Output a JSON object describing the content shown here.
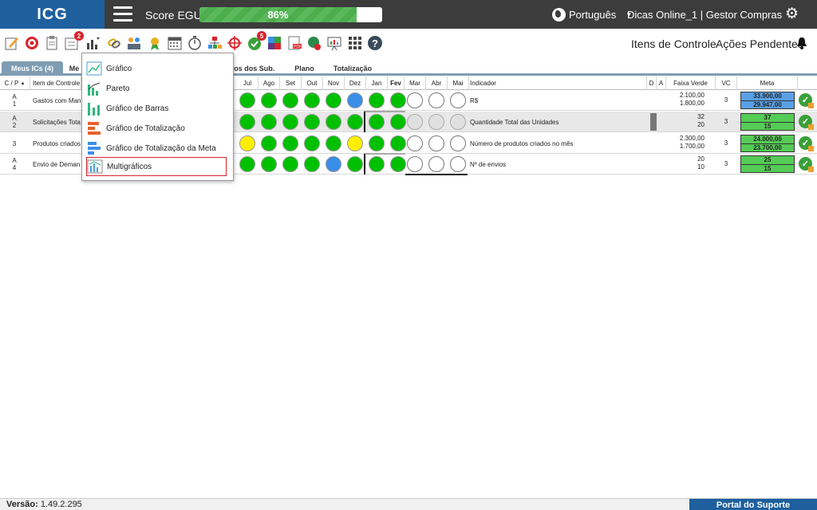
{
  "app": {
    "logo": "ICG"
  },
  "header": {
    "score_label": "Score EGU:",
    "score_value": "86%",
    "score_fraction": 0.86,
    "language": "Português",
    "user": "Dicas Online_1  |  Gestor Compras"
  },
  "toolbar": {
    "right_items": [
      "Itens de Controle",
      "Ações Pendentes"
    ],
    "badges": {
      "list": "2",
      "check": "5"
    }
  },
  "tabs": [
    {
      "label": "Meus ICs (4)"
    },
    {
      "label": "Me"
    },
    {
      "label": "hos dos Sub."
    },
    {
      "label": "Plano"
    },
    {
      "label": "Totalização"
    }
  ],
  "table": {
    "headers": {
      "cp": "C / P",
      "item": "Item de Controle",
      "months": [
        "Jul",
        "Ago",
        "Set",
        "Out",
        "Nov",
        "Dez",
        "Jan",
        "Fev",
        "Mar",
        "Abr",
        "Mai"
      ],
      "indicator": "Indicador",
      "d": "D",
      "a": "A",
      "faixa": "Faixa Verde",
      "vc": "VC",
      "meta": "Meta"
    },
    "rows": [
      {
        "c": "A",
        "p": "1",
        "item": "Gastos com Man",
        "indicator": "R$",
        "faixa": [
          "2.100,00",
          "1.800,00"
        ],
        "vc": "3",
        "meta": [
          "33.900,00",
          "29.947,00"
        ],
        "meta_color": "#5aa0e6",
        "status": [
          "green",
          "green",
          "green",
          "green",
          "green",
          "blue",
          "green",
          "green",
          "empty",
          "empty",
          "empty"
        ]
      },
      {
        "c": "A",
        "p": "2",
        "item": "Solicitações Tota",
        "indicator": "Quantidade Total das Unidades",
        "faixa": [
          "32",
          "20"
        ],
        "vc": "3",
        "meta": [
          "37",
          "15"
        ],
        "meta_color": "#55cc55",
        "status": [
          "green",
          "green",
          "green",
          "green",
          "green",
          "green",
          "green",
          "green",
          "grey",
          "grey",
          "grey"
        ]
      },
      {
        "c": "",
        "p": "3",
        "item": "Produtos criados",
        "indicator": "Número de produtos criados no mês",
        "faixa": [
          "2.300,00",
          "1.700,00"
        ],
        "vc": "3",
        "meta": [
          "24.000,00",
          "23.700,00"
        ],
        "meta_color": "#55cc55",
        "status": [
          "yellow",
          "green",
          "green",
          "green",
          "green",
          "yellow",
          "green",
          "green",
          "empty",
          "empty",
          "empty"
        ]
      },
      {
        "c": "A",
        "p": "4",
        "item": "Envio de Deman",
        "indicator": "Nº de envios",
        "faixa": [
          "20",
          "10"
        ],
        "vc": "3",
        "meta": [
          "25",
          "15"
        ],
        "meta_color": "#55cc55",
        "status": [
          "green",
          "green",
          "green",
          "green",
          "blue",
          "green",
          "green",
          "green",
          "empty",
          "empty",
          "empty"
        ]
      }
    ]
  },
  "dropdown": {
    "items": [
      {
        "label": "Gráfico",
        "icon": "line-chart-icon"
      },
      {
        "label": "Pareto",
        "icon": "pareto-icon"
      },
      {
        "label": "Gráfico de Barras",
        "icon": "bar-chart-icon"
      },
      {
        "label": "Gráfico de Totalização",
        "icon": "totalization-chart-icon"
      },
      {
        "label": "Gráfico de Totalização da Meta",
        "icon": "goal-totalization-chart-icon"
      },
      {
        "label": "Multigráficos",
        "icon": "multi-chart-icon"
      }
    ]
  },
  "footer": {
    "version_label": "Versão:",
    "version": "1.49.2.295",
    "support": "Portal do Suporte"
  },
  "colors": {
    "green": "#00c000",
    "blue": "#3a8ee8",
    "yellow": "#ffee00",
    "grey": "#e0e0e0",
    "empty": "#ffffff",
    "brand": "#1e5f9e"
  }
}
